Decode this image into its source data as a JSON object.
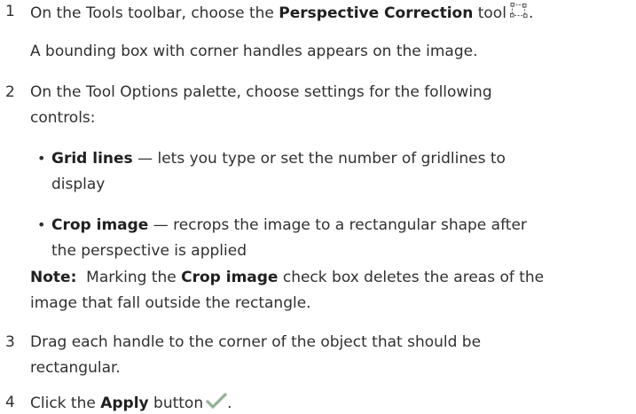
{
  "steps": [
    {
      "number": "1",
      "pre": "On the Tools toolbar, choose the ",
      "bold": "Perspective Correction",
      "post": " tool",
      "icon": "perspective-correction-icon",
      "end": ".",
      "result": "A bounding box with corner handles appears on the image."
    },
    {
      "number": "2",
      "line1": "On the Tool Options palette, choose settings for the following",
      "line2": "controls:",
      "bullets": [
        {
          "bold": "Grid lines",
          "line1": " — lets you type or set the number of gridlines to",
          "line2": "display"
        },
        {
          "bold": "Crop image",
          "line1": " — recrops the image to a rectangular shape after",
          "line2": "the perspective is applied"
        }
      ],
      "note": {
        "label": "Note:",
        "pre": "  Marking the ",
        "bold": "Crop image",
        "post": " check box deletes the areas of the",
        "line2": "image that fall outside the rectangle."
      }
    },
    {
      "number": "3",
      "line1": "Drag each handle to the corner of the object that should be",
      "line2": "rectangular."
    },
    {
      "number": "4",
      "pre": "Click the ",
      "bold": "Apply",
      "post": " button",
      "icon": "apply-checkmark-icon",
      "end": "."
    }
  ]
}
